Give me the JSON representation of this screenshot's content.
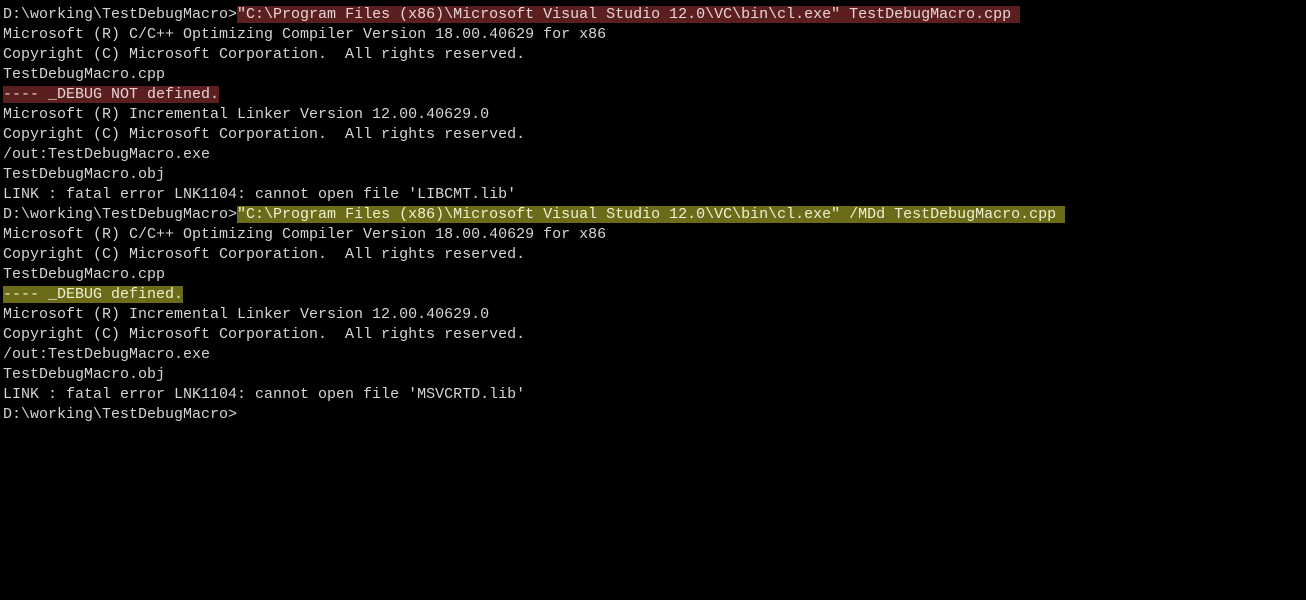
{
  "lines": [
    {
      "segments": [
        {
          "text": "D:\\working\\TestDebugMacro>",
          "cls": "prompt"
        },
        {
          "text": "\"C:\\Program Files (x86)\\Microsoft Visual Studio 12.0\\VC\\bin\\cl.exe\" TestDebugMacro.cpp ",
          "cls": "hl-red"
        }
      ]
    },
    {
      "segments": [
        {
          "text": "Microsoft (R) C/C++ Optimizing Compiler Version 18.00.40629 for x86",
          "cls": ""
        }
      ]
    },
    {
      "segments": [
        {
          "text": "Copyright (C) Microsoft Corporation.  All rights reserved.",
          "cls": ""
        }
      ]
    },
    {
      "segments": [
        {
          "text": "",
          "cls": ""
        }
      ]
    },
    {
      "segments": [
        {
          "text": "TestDebugMacro.cpp",
          "cls": ""
        }
      ]
    },
    {
      "segments": [
        {
          "text": "---- _DEBUG NOT defined.",
          "cls": "hl-red"
        }
      ]
    },
    {
      "segments": [
        {
          "text": "Microsoft (R) Incremental Linker Version 12.00.40629.0",
          "cls": ""
        }
      ]
    },
    {
      "segments": [
        {
          "text": "Copyright (C) Microsoft Corporation.  All rights reserved.",
          "cls": ""
        }
      ]
    },
    {
      "segments": [
        {
          "text": "",
          "cls": ""
        }
      ]
    },
    {
      "segments": [
        {
          "text": "/out:TestDebugMacro.exe",
          "cls": ""
        }
      ]
    },
    {
      "segments": [
        {
          "text": "TestDebugMacro.obj",
          "cls": ""
        }
      ]
    },
    {
      "segments": [
        {
          "text": "LINK : fatal error LNK1104: cannot open file 'LIBCMT.lib'",
          "cls": ""
        }
      ]
    },
    {
      "segments": [
        {
          "text": "",
          "cls": ""
        }
      ]
    },
    {
      "segments": [
        {
          "text": "D:\\working\\TestDebugMacro>",
          "cls": "prompt"
        },
        {
          "text": "\"C:\\Program Files (x86)\\Microsoft Visual Studio 12.0\\VC\\bin\\cl.exe\" /MDd TestDebugMacro.cpp ",
          "cls": "hl-yellow"
        }
      ]
    },
    {
      "segments": [
        {
          "text": "Microsoft (R) C/C++ Optimizing Compiler Version 18.00.40629 for x86",
          "cls": ""
        }
      ]
    },
    {
      "segments": [
        {
          "text": "Copyright (C) Microsoft Corporation.  All rights reserved.",
          "cls": ""
        }
      ]
    },
    {
      "segments": [
        {
          "text": "",
          "cls": ""
        }
      ]
    },
    {
      "segments": [
        {
          "text": "TestDebugMacro.cpp",
          "cls": ""
        }
      ]
    },
    {
      "segments": [
        {
          "text": "---- _DEBUG defined.",
          "cls": "hl-yellow"
        }
      ]
    },
    {
      "segments": [
        {
          "text": "Microsoft (R) Incremental Linker Version 12.00.40629.0",
          "cls": ""
        }
      ]
    },
    {
      "segments": [
        {
          "text": "Copyright (C) Microsoft Corporation.  All rights reserved.",
          "cls": ""
        }
      ]
    },
    {
      "segments": [
        {
          "text": "",
          "cls": ""
        }
      ]
    },
    {
      "segments": [
        {
          "text": "/out:TestDebugMacro.exe",
          "cls": ""
        }
      ]
    },
    {
      "segments": [
        {
          "text": "TestDebugMacro.obj",
          "cls": ""
        }
      ]
    },
    {
      "segments": [
        {
          "text": "LINK : fatal error LNK1104: cannot open file 'MSVCRTD.lib'",
          "cls": ""
        }
      ]
    },
    {
      "segments": [
        {
          "text": "",
          "cls": ""
        }
      ]
    },
    {
      "segments": [
        {
          "text": "D:\\working\\TestDebugMacro>",
          "cls": "prompt"
        }
      ]
    }
  ]
}
